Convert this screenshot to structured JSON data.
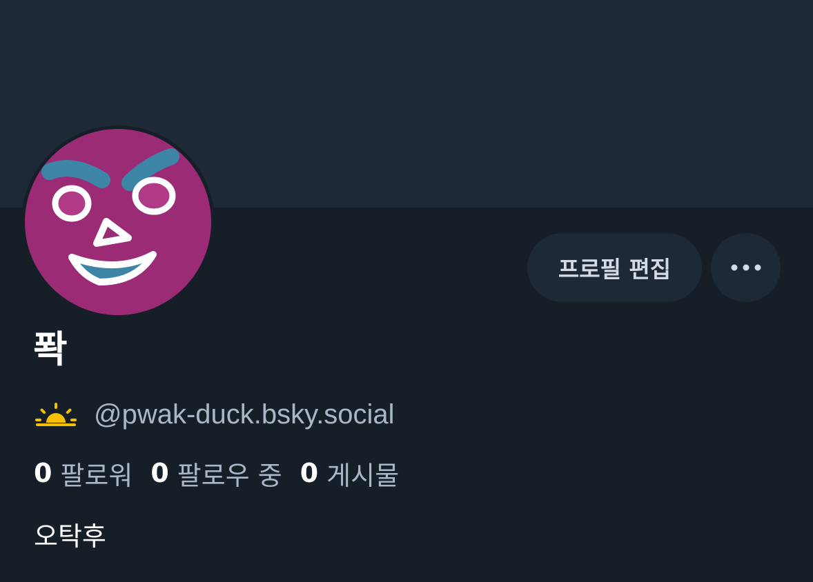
{
  "profile": {
    "display_name": "퐉",
    "handle": "@pwak-duck.bsky.social",
    "bio": "오탁후",
    "avatar_icon": "face-avatar",
    "status_icon": "sunrise-icon"
  },
  "actions": {
    "edit_profile_label": "프로필 편집",
    "more_icon": "more-icon"
  },
  "stats": [
    {
      "count": "0",
      "label": "팔로워"
    },
    {
      "count": "0",
      "label": "팔로우 중"
    },
    {
      "count": "0",
      "label": "게시물"
    }
  ],
  "colors": {
    "background": "#161e27",
    "banner": "#1e2936",
    "button_bg": "#1e2936",
    "secondary_text": "#a9b7c6",
    "accent_sun": "#f5c000",
    "avatar_magenta": "#9c2b76",
    "avatar_blue": "#3d85a6"
  }
}
